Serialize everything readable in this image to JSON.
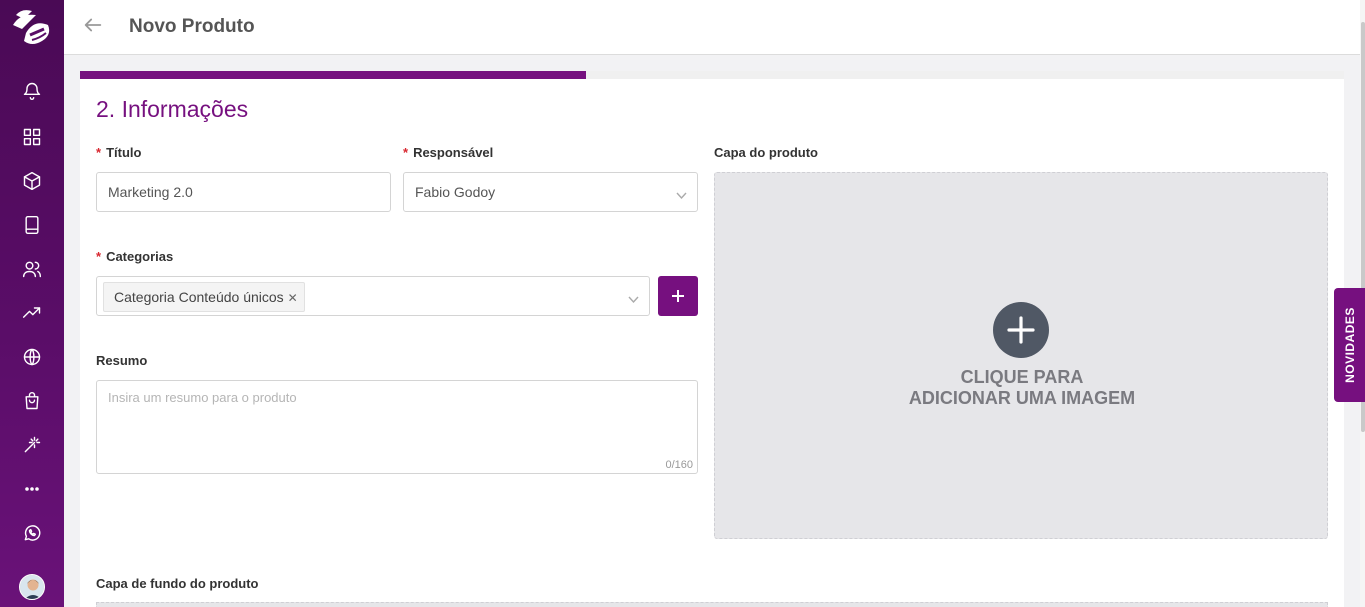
{
  "header": {
    "title": "Novo Produto"
  },
  "progress": {
    "fraction": 0.4
  },
  "section": {
    "title": "2. Informações"
  },
  "form": {
    "titulo": {
      "label": "Título",
      "value": "Marketing 2.0"
    },
    "responsavel": {
      "label": "Responsável",
      "value": "Fabio Godoy"
    },
    "categorias": {
      "label": "Categorias",
      "tags": [
        "Categoria Conteúdo únicos"
      ]
    },
    "resumo": {
      "label": "Resumo",
      "placeholder": "Insira um resumo para o produto",
      "counter": "0/160"
    },
    "required_marker": "*"
  },
  "cover": {
    "label": "Capa do produto",
    "line1": "CLIQUE PARA",
    "line2": "ADICIONAR UMA IMAGEM"
  },
  "background_cover": {
    "label": "Capa de fundo do produto"
  },
  "novidades": {
    "label": "NOVIDADES"
  },
  "sidebar": {
    "icons": [
      "bell-icon",
      "grid-icon",
      "box-icon",
      "book-icon",
      "users-icon",
      "trending-icon",
      "globe-icon",
      "shopping-bag-icon",
      "magic-wand-icon",
      "more-icon",
      "whatsapp-icon"
    ]
  },
  "colors": {
    "accent": "#76107f",
    "sidebar": "#5a0d68",
    "required": "#d8262f"
  }
}
